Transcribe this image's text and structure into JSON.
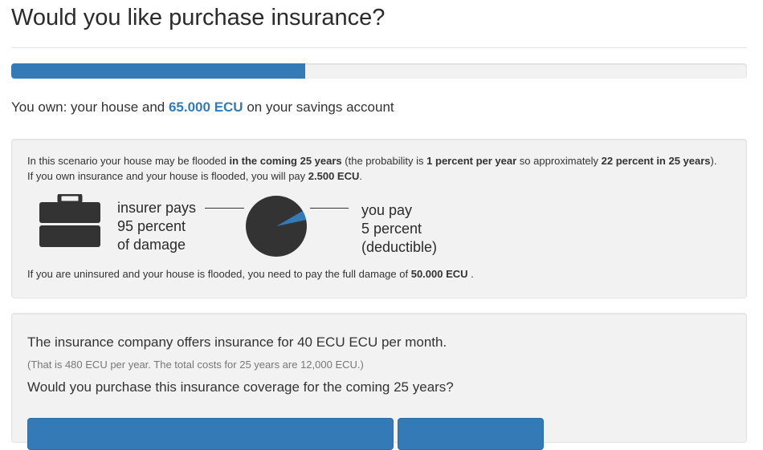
{
  "page": {
    "title": "Would you like purchase insurance?"
  },
  "progress": {
    "fraction": 0.4
  },
  "ownership": {
    "prefix": "You own: your house and ",
    "amount": "65.000 ECU",
    "suffix": " on your savings account"
  },
  "scenario": {
    "line1_a": "In this scenario your house may be flooded ",
    "line1_b": "in the coming 25 years",
    "line1_c": " (the probability is ",
    "line1_d": "1 percent per year",
    "line1_e": " so approximately ",
    "line1_f": "22 percent in 25 years",
    "line1_g": ").",
    "line2_a": "If you own insurance and your house is flooded, you will pay ",
    "line2_b": "2.500 ECU",
    "line2_c": ".",
    "insurer_line1": "insurer pays",
    "insurer_line2": "95 percent",
    "insurer_line3": "of damage",
    "you_line1": "you pay",
    "you_line2": "5 percent",
    "you_line3": "(deductible)",
    "deductible_fraction": 0.05,
    "pie_color_main": "#333333",
    "pie_color_slice": "#337ab7",
    "line3_a": "If you are uninsured and your house is flooded, you need to pay the full damage of ",
    "line3_b": "50.000 ECU",
    "line3_c": " ."
  },
  "offer": {
    "title": "The insurance company offers insurance for 40 ECU ECU per month.",
    "subtitle": "(That is 480 ECU per year. The total costs for 25 years are 12,000 ECU.)",
    "question": "Would you purchase this insurance coverage for the coming 25 years?"
  },
  "colors": {
    "accent": "#337ab7",
    "panel_bg": "#f2f2f2"
  },
  "icons": {
    "briefcase": "briefcase-icon"
  }
}
